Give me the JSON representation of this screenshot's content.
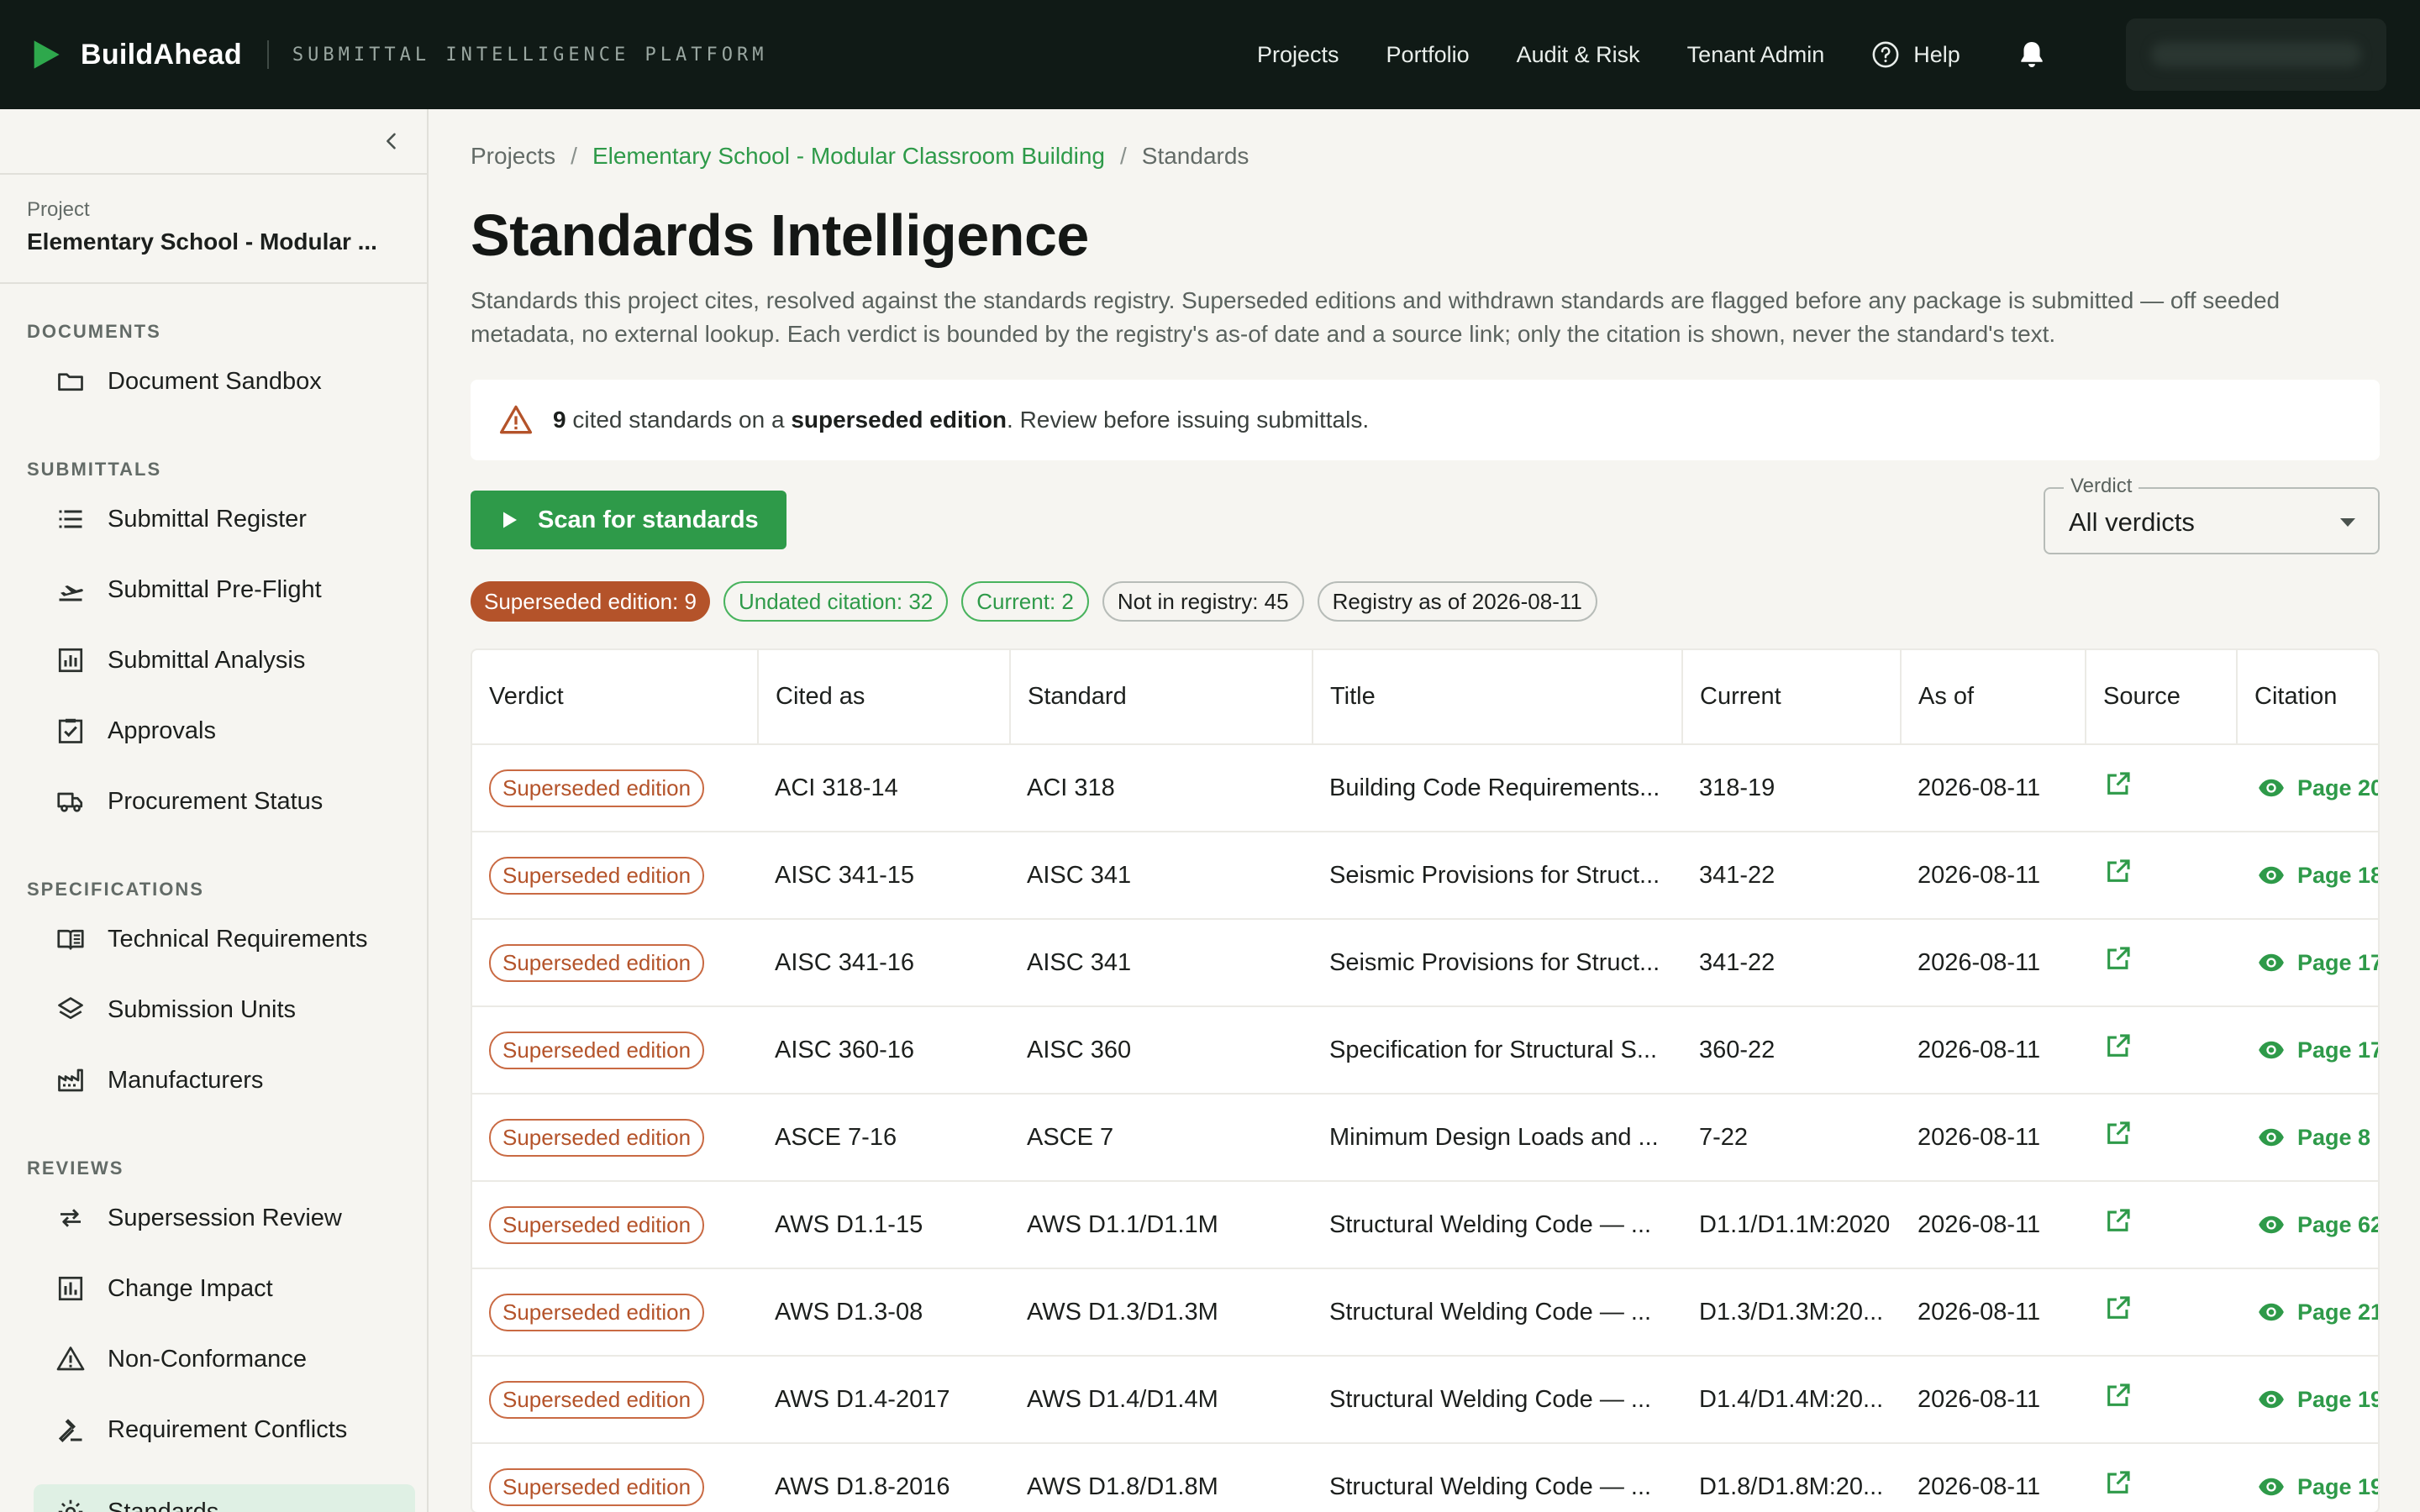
{
  "header": {
    "brand": "BuildAhead",
    "tagline": "SUBMITTAL INTELLIGENCE PLATFORM",
    "nav": [
      "Projects",
      "Portfolio",
      "Audit & Risk",
      "Tenant Admin"
    ],
    "help_label": "Help",
    "accent": "#2e9a49",
    "background": "#101a16"
  },
  "sidebar": {
    "project_label": "Project",
    "project_name": "Elementary School - Modular ...",
    "sections": {
      "documents": "DOCUMENTS",
      "submittals": "SUBMITTALS",
      "specifications": "SPECIFICATIONS",
      "reviews": "REVIEWS"
    },
    "items": {
      "document_sandbox": "Document Sandbox",
      "submittal_register": "Submittal Register",
      "submittal_preflight": "Submittal Pre-Flight",
      "submittal_analysis": "Submittal Analysis",
      "approvals": "Approvals",
      "procurement_status": "Procurement Status",
      "technical_requirements": "Technical Requirements",
      "submission_units": "Submission Units",
      "manufacturers": "Manufacturers",
      "supersession_review": "Supersession Review",
      "change_impact": "Change Impact",
      "non_conformance": "Non-Conformance",
      "requirement_conflicts": "Requirement Conflicts",
      "standards": "Standards"
    }
  },
  "breadcrumb": {
    "projects": "Projects",
    "project": "Elementary School - Modular Classroom Building",
    "current": "Standards",
    "separator": "/"
  },
  "page": {
    "title": "Standards Intelligence",
    "description": "Standards this project cites, resolved against the standards registry. Superseded editions and withdrawn standards are flagged before any package is submitted — off seeded metadata, no external lookup. Each verdict is bounded by the registry's as-of date and a source link; only the citation is shown, never the standard's text."
  },
  "alert": {
    "count": "9",
    "text_before": "cited standards on a",
    "emphasis": "superseded edition",
    "text_after": ". Review before issuing submittals."
  },
  "actions": {
    "scan_label": "Scan for standards"
  },
  "filter": {
    "label": "Verdict",
    "value": "All verdicts"
  },
  "chips": {
    "superseded": "Superseded edition: 9",
    "undated": "Undated citation: 32",
    "current": "Current: 2",
    "not_in_registry": "Not in registry: 45",
    "registry_as_of": "Registry as of 2026-08-11"
  },
  "table": {
    "columns": {
      "verdict": "Verdict",
      "cited_as": "Cited as",
      "standard": "Standard",
      "title": "Title",
      "current": "Current",
      "as_of": "As of",
      "source": "Source",
      "citation": "Citation"
    },
    "rows": [
      {
        "verdict": "Superseded edition",
        "cited_as": "ACI 318-14",
        "standard": "ACI 318",
        "title": "Building Code Requirements...",
        "current": "318-19",
        "as_of": "2026-08-11",
        "citation": "Page 20"
      },
      {
        "verdict": "Superseded edition",
        "cited_as": "AISC 341-15",
        "standard": "AISC 341",
        "title": "Seismic Provisions for Struct...",
        "current": "341-22",
        "as_of": "2026-08-11",
        "citation": "Page 18"
      },
      {
        "verdict": "Superseded edition",
        "cited_as": "AISC 341-16",
        "standard": "AISC 341",
        "title": "Seismic Provisions for Struct...",
        "current": "341-22",
        "as_of": "2026-08-11",
        "citation": "Page 17"
      },
      {
        "verdict": "Superseded edition",
        "cited_as": "AISC 360-16",
        "standard": "AISC 360",
        "title": "Specification for Structural S...",
        "current": "360-22",
        "as_of": "2026-08-11",
        "citation": "Page 17"
      },
      {
        "verdict": "Superseded edition",
        "cited_as": "ASCE 7-16",
        "standard": "ASCE 7",
        "title": "Minimum Design Loads and ...",
        "current": "7-22",
        "as_of": "2026-08-11",
        "citation": "Page 8"
      },
      {
        "verdict": "Superseded edition",
        "cited_as": "AWS D1.1-15",
        "standard": "AWS D1.1/D1.1M",
        "title": "Structural Welding Code — ...",
        "current": "D1.1/D1.1M:2020",
        "as_of": "2026-08-11",
        "citation": "Page 62"
      },
      {
        "verdict": "Superseded edition",
        "cited_as": "AWS D1.3-08",
        "standard": "AWS D1.3/D1.3M",
        "title": "Structural Welding Code — ...",
        "current": "D1.3/D1.3M:20...",
        "as_of": "2026-08-11",
        "citation": "Page 21"
      },
      {
        "verdict": "Superseded edition",
        "cited_as": "AWS D1.4-2017",
        "standard": "AWS D1.4/D1.4M",
        "title": "Structural Welding Code — ...",
        "current": "D1.4/D1.4M:20...",
        "as_of": "2026-08-11",
        "citation": "Page 19"
      },
      {
        "verdict": "Superseded edition",
        "cited_as": "AWS D1.8-2016",
        "standard": "AWS D1.8/D1.8M",
        "title": "Structural Welding Code — ...",
        "current": "D1.8/D1.8M:20...",
        "as_of": "2026-08-11",
        "citation": "Page 19"
      }
    ]
  }
}
